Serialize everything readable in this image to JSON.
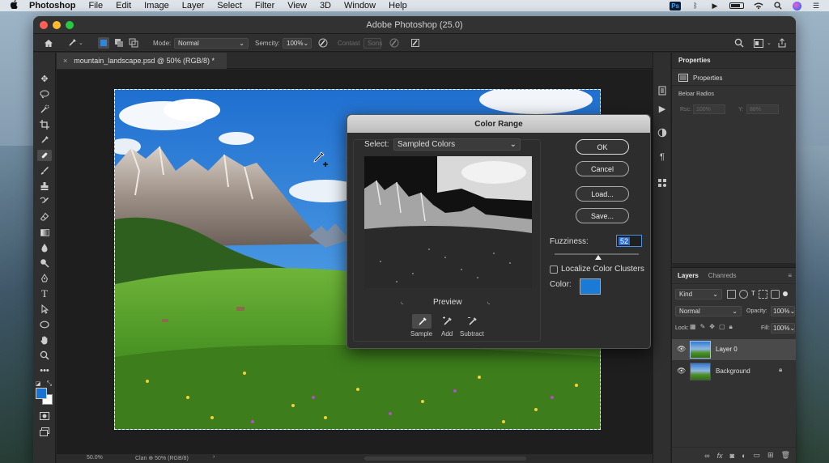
{
  "menubar": {
    "app_name": "Photoshop",
    "items": [
      "File",
      "Edit",
      "Image",
      "Layer",
      "Select",
      "Filter",
      "View",
      "3D",
      "Window",
      "Help"
    ],
    "ps_badge": "Ps"
  },
  "window": {
    "title": "Adobe Photoshop (25.0)"
  },
  "options_bar": {
    "mode_label": "Mode:",
    "mode_value": "Normal",
    "semicity_label": "Semcity:",
    "semicity_value": "100%",
    "contast_label": "Contast",
    "sons_label": "Sons"
  },
  "document_tab": {
    "close": "×",
    "title": "mountain_landscape.psd @ 50% (RGB/8) *"
  },
  "status_bar": {
    "zoom": "50.0%",
    "info": "Clan ⊕ 50% (RGB/8)",
    "arrow": "›"
  },
  "properties_panel": {
    "title": "Properties",
    "sub_title": "Properties",
    "section_label": "Beloar Radios",
    "rsc_label": "Rsc:",
    "rsc_value": "100%",
    "y_label": "Y:",
    "y_value": "88%"
  },
  "layers_panel": {
    "tab_layers": "Layers",
    "tab_channels": "Chanreds",
    "kind_value": "Kind",
    "blend_value": "Normal",
    "opacity_label": "Opacity:",
    "opacity_value": "100%",
    "lock_label": "Lock:",
    "fill_label": "Fill:",
    "fill_value": "100%",
    "layers": [
      {
        "name": "Layer 0",
        "selected": true
      },
      {
        "name": "Background",
        "selected": false
      }
    ]
  },
  "color_range": {
    "title": "Color Range",
    "select_label": "Select:",
    "select_value": "Sampled Colors",
    "preview_label": "Preview",
    "buttons": {
      "ok": "OK",
      "cancel": "Cancel",
      "load": "Load...",
      "save": "Save..."
    },
    "fuzziness_label": "Fuzziness:",
    "fuzziness_value": "52",
    "fuzziness_fraction": 0.52,
    "localize_label": "Localize Color Clusters",
    "color_label": "Color:",
    "color_swatch": "#1a7bd6",
    "eyedroppers": [
      "Sample",
      "Add",
      "Subtract"
    ]
  },
  "colors": {
    "foreground": "#1a73d0",
    "background": "#ffffff",
    "accent": "#2b6fd6"
  }
}
